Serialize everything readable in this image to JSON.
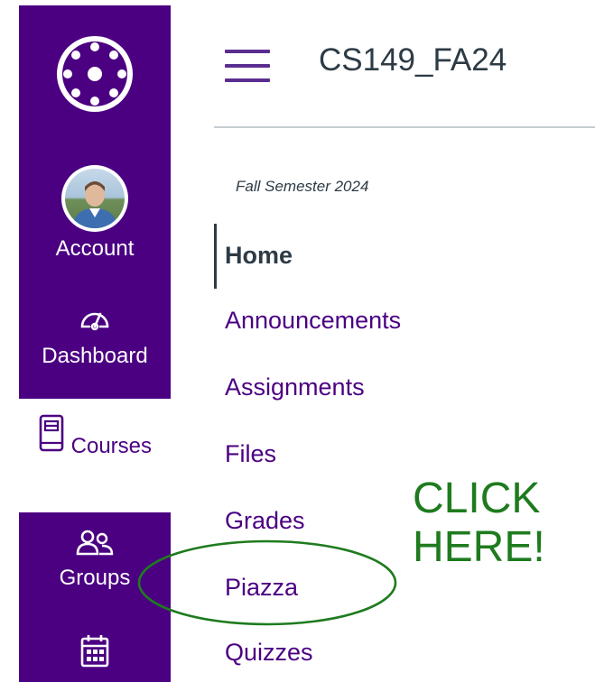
{
  "global_nav": {
    "items": [
      {
        "label": "Account",
        "icon": "avatar"
      },
      {
        "label": "Dashboard",
        "icon": "dashboard-icon"
      },
      {
        "label": "Courses",
        "icon": "courses-icon",
        "active": true
      },
      {
        "label": "Groups",
        "icon": "groups-icon"
      },
      {
        "label": "",
        "icon": "calendar-icon"
      }
    ],
    "colors": {
      "background": "#4b0082",
      "active_background": "#ffffff",
      "active_text": "#4b0082"
    }
  },
  "course": {
    "title": "CS149_FA24",
    "term": "Fall Semester 2024",
    "nav": [
      {
        "label": "Home",
        "active": true
      },
      {
        "label": "Announcements"
      },
      {
        "label": "Assignments"
      },
      {
        "label": "Files"
      },
      {
        "label": "Grades"
      },
      {
        "label": "Piazza"
      },
      {
        "label": "Quizzes"
      }
    ]
  },
  "annotation": {
    "line1": "CLICK",
    "line2": "HERE!",
    "color": "#1e7b1e"
  }
}
